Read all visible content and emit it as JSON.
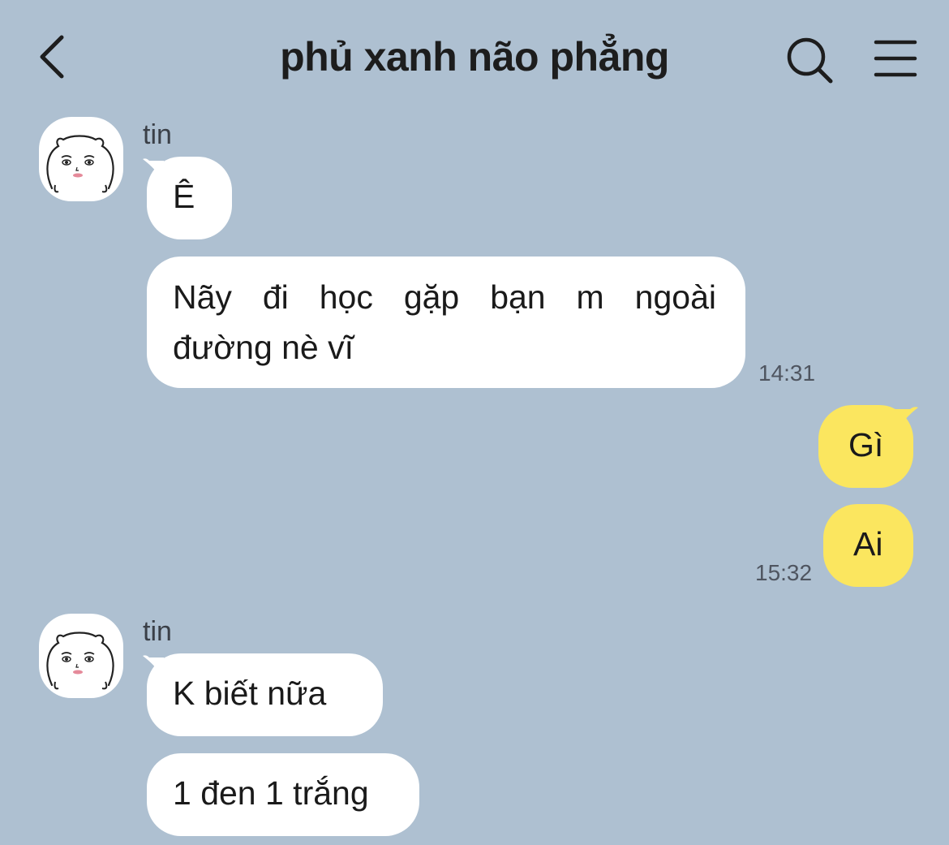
{
  "header": {
    "title": "phủ xanh não phẳng",
    "back_icon": "chevron-left-icon",
    "search_icon": "search-icon",
    "menu_icon": "hamburger-menu-icon"
  },
  "colors": {
    "background": "#aec0d1",
    "incoming_bubble": "#ffffff",
    "outgoing_bubble": "#fbe65f"
  },
  "messages": [
    {
      "sender": "tin",
      "text": "Ê"
    },
    {
      "sender": "tin",
      "line1": "Nãy đi học gặp bạn m ngoài",
      "line2": "đường nè vĩ",
      "time": "14:31"
    },
    {
      "sender": "me",
      "text": "Gì"
    },
    {
      "sender": "me",
      "text": "Ai",
      "time": "15:32"
    },
    {
      "sender": "tin",
      "text": "K biết nữa"
    },
    {
      "sender": "tin",
      "text": "1 đen 1 trắng"
    }
  ]
}
